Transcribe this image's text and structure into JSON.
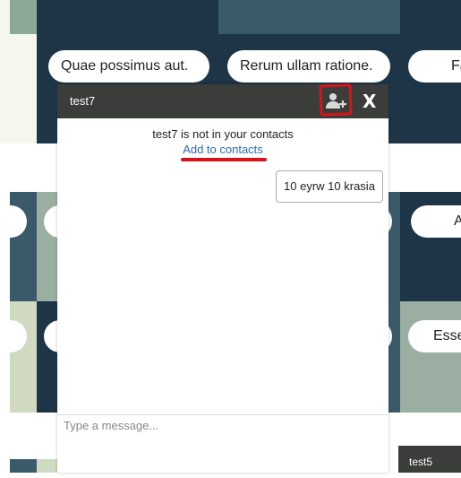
{
  "background": {
    "cards": [
      {
        "label": "Quae possimus aut."
      },
      {
        "label": "Rerum ullam ratione."
      },
      {
        "label": "Fa"
      },
      {
        "label": "A"
      },
      {
        "label": "Esse"
      }
    ]
  },
  "chat": {
    "title": "test7",
    "notice": "test7 is not in your contacts",
    "add_link": "Add to contacts",
    "close_label": "X",
    "messages": [
      {
        "text": "10 eyrw 10 krasia"
      }
    ],
    "input_placeholder": "Type a message..."
  },
  "minimized_chat": {
    "title": "test5"
  },
  "colors": {
    "dark_tile": "#1e3447",
    "slate_tile": "#3a5a6a",
    "sage_tile": "#9aafa1",
    "pale_tile": "#cfdac1",
    "header": "#3b3d3a",
    "annotation_red": "#d8141b",
    "link_blue": "#2a6db8"
  },
  "icons": {
    "add_contact": "add-user-icon"
  }
}
